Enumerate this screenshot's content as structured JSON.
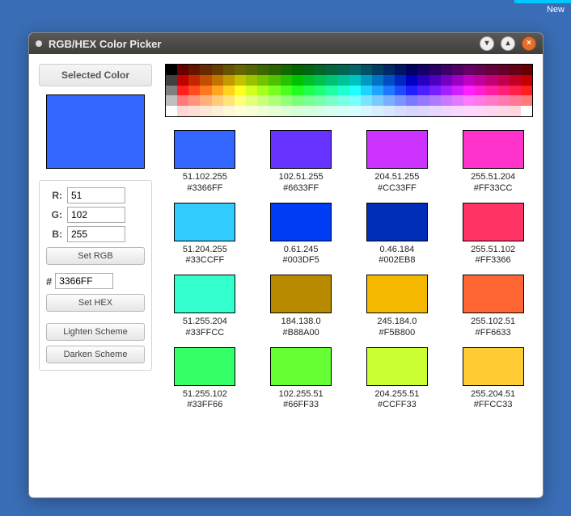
{
  "desktop": {
    "new_label": "New"
  },
  "window": {
    "title": "RGB/HEX Color Picker"
  },
  "selected": {
    "heading": "Selected Color",
    "swatch_hex": "#3366FF",
    "r_label": "R:",
    "g_label": "G:",
    "b_label": "B:",
    "r_value": "51",
    "g_value": "102",
    "b_value": "255",
    "set_rgb_label": "Set RGB",
    "hash": "#",
    "hex_value": "3366FF",
    "set_hex_label": "Set HEX",
    "lighten_label": "Lighten Scheme",
    "darken_label": "Darken Scheme"
  },
  "scheme": [
    {
      "hex": "#3366FF",
      "rgb": "51.102.255"
    },
    {
      "hex": "#6633FF",
      "rgb": "102.51.255"
    },
    {
      "hex": "#CC33FF",
      "rgb": "204.51.255"
    },
    {
      "hex": "#FF33CC",
      "rgb": "255.51.204"
    },
    {
      "hex": "#33CCFF",
      "rgb": "51.204.255"
    },
    {
      "hex": "#003DF5",
      "rgb": "0.61.245"
    },
    {
      "hex": "#002EB8",
      "rgb": "0.46.184"
    },
    {
      "hex": "#FF3366",
      "rgb": "255.51.102"
    },
    {
      "hex": "#33FFCC",
      "rgb": "51.255.204"
    },
    {
      "hex": "#B88A00",
      "rgb": "184.138.0"
    },
    {
      "hex": "#F5B800",
      "rgb": "245.184.0"
    },
    {
      "hex": "#FF6633",
      "rgb": "255.102.51"
    },
    {
      "hex": "#33FF66",
      "rgb": "51.255.102"
    },
    {
      "hex": "#66FF33",
      "rgb": "102.255.51"
    },
    {
      "hex": "#CCFF33",
      "rgb": "204.255.51"
    },
    {
      "hex": "#FFCC33",
      "rgb": "255.204.51"
    }
  ]
}
